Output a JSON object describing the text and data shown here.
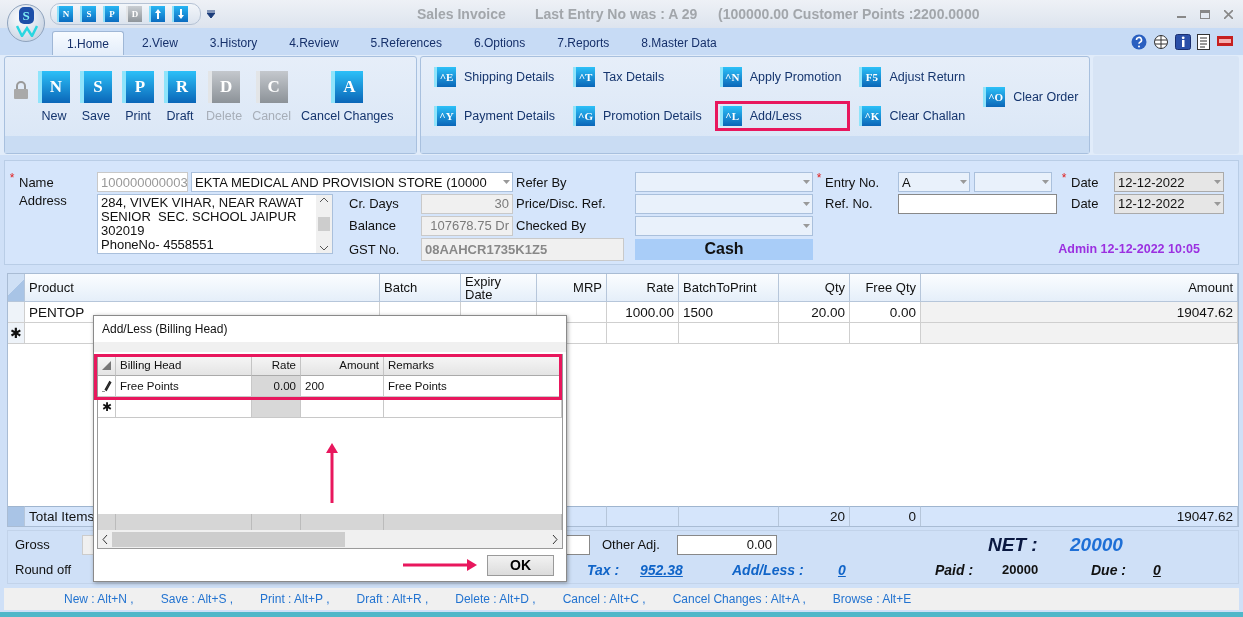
{
  "window": {
    "logo_letter": "S",
    "title": "Sales Invoice",
    "last_entry": "Last Entry No was : A 29",
    "points": "(100000.00  Customer Points :2200.0000"
  },
  "quick_access": [
    {
      "kind": "letter",
      "key": "N",
      "disabled": false
    },
    {
      "kind": "letter",
      "key": "S",
      "disabled": false
    },
    {
      "kind": "letter",
      "key": "P",
      "disabled": false
    },
    {
      "kind": "letter",
      "key": "D",
      "disabled": true
    },
    {
      "kind": "up",
      "disabled": false
    },
    {
      "kind": "down",
      "disabled": false
    }
  ],
  "tabs": [
    {
      "label": "1.Home",
      "selected": true
    },
    {
      "label": "2.View",
      "selected": false
    },
    {
      "label": "3.History",
      "selected": false
    },
    {
      "label": "4.Review",
      "selected": false
    },
    {
      "label": "5.References",
      "selected": false
    },
    {
      "label": "6.Options",
      "selected": false
    },
    {
      "label": "7.Reports",
      "selected": false
    },
    {
      "label": "8.Master Data",
      "selected": false
    }
  ],
  "ribbon": {
    "main_buttons": [
      {
        "key": "N",
        "label": "New",
        "disabled": false
      },
      {
        "key": "S",
        "label": "Save",
        "disabled": false
      },
      {
        "key": "P",
        "label": "Print",
        "disabled": false
      },
      {
        "key": "R",
        "label": "Draft",
        "disabled": false
      },
      {
        "key": "D",
        "label": "Delete",
        "disabled": true
      },
      {
        "key": "C",
        "label": "Cancel",
        "disabled": true
      },
      {
        "key": "A",
        "label": "Cancel Changes",
        "disabled": false
      }
    ],
    "actions": [
      [
        {
          "key": "^E",
          "label": "Shipping Details",
          "highlighted": false
        },
        {
          "key": "^Y",
          "label": "Payment Details",
          "highlighted": false
        }
      ],
      [
        {
          "key": "^T",
          "label": "Tax Details",
          "highlighted": false
        },
        {
          "key": "^G",
          "label": "Promotion Details",
          "highlighted": false
        }
      ],
      [
        {
          "key": "^N",
          "label": "Apply Promotion",
          "highlighted": false
        },
        {
          "key": "^L",
          "label": "Add/Less",
          "highlighted": true
        }
      ],
      [
        {
          "key": "F5",
          "label": "Adjust Return",
          "highlighted": false
        },
        {
          "key": "^K",
          "label": "Clear Challan",
          "highlighted": false
        }
      ],
      [
        {
          "key": "^O",
          "label": "Clear Order",
          "highlighted": false
        }
      ]
    ]
  },
  "customer": {
    "name_label": "Name",
    "required_mark": "*",
    "address_label": "Address",
    "code": "100000000003",
    "name": "EKTA MEDICAL AND PROVISION STORE (10000",
    "address": "284, VIVEK VIHAR, NEAR RAWAT\nSENIOR  SEC. SCHOOL JAIPUR\n302019\nPhoneNo- 4558551",
    "details": [
      {
        "label": "Cr. Days",
        "value": "30"
      },
      {
        "label": "Balance",
        "value": "107678.75 Dr"
      },
      {
        "label": "GST No.",
        "value": "08AAHCR1735K1Z5"
      }
    ]
  },
  "references": [
    {
      "label": "Refer By"
    },
    {
      "label": "Price/Disc. Ref."
    },
    {
      "label": "Checked By"
    }
  ],
  "payment_mode": "Cash",
  "entry": {
    "label": "Entry No.",
    "required_mark": "*",
    "series": "A",
    "ref_label": "Ref. No.",
    "dates": [
      {
        "label": "Date",
        "value": "12-12-2022",
        "required_mark": "*"
      },
      {
        "label": "Date",
        "value": "12-12-2022"
      }
    ],
    "user_stamp": "Admin 12-12-2022 10:05"
  },
  "grid": {
    "columns": [
      {
        "label": "Product",
        "kind": "text"
      },
      {
        "label": "Batch",
        "kind": "text"
      },
      {
        "label": "Expiry Date",
        "kind": "text"
      },
      {
        "label": "MRP",
        "kind": "number"
      },
      {
        "label": "Rate",
        "kind": "number"
      },
      {
        "label": "BatchToPrint",
        "kind": "text"
      },
      {
        "label": "Qty",
        "kind": "number"
      },
      {
        "label": "Free Qty",
        "kind": "number"
      },
      {
        "label": "Amount",
        "kind": "number"
      }
    ],
    "rows": [
      {
        "kind": "data",
        "cells": [
          "PENTOP",
          null,
          null,
          null,
          "1000.00",
          "1500",
          "20.00",
          "0.00",
          "19047.62"
        ]
      },
      {
        "kind": "new",
        "marker": "✱"
      }
    ],
    "totals": {
      "label": "Total Items",
      "cells": [
        null,
        null,
        null,
        null,
        null,
        "20",
        "0",
        "19047.62"
      ]
    }
  },
  "summary": {
    "gross_label": "Gross",
    "round_off_label": "Round off",
    "other_adj_label": "Other Adj.",
    "other_adj": "0.00",
    "tax_label": "Tax :",
    "tax": "952.38",
    "add_less_label": "Add/Less :",
    "add_less": "0",
    "net_label": "NET :",
    "net": "20000",
    "paid_label": "Paid :",
    "paid": "20000",
    "due_label": "Due :",
    "due": "0"
  },
  "shortcuts": [
    "New : Alt+N ,",
    "Save : Alt+S ,",
    "Print : Alt+P ,",
    "Draft : Alt+R ,",
    "Delete : Alt+D ,",
    "Cancel : Alt+C ,",
    "Cancel Changes : Alt+A ,",
    "Browse : Alt+E"
  ],
  "dialog": {
    "title": "Add/Less (Billing Head)",
    "highlighted": true,
    "columns": [
      {
        "label": "Billing Head",
        "kind": "text",
        "readonly": false
      },
      {
        "label": "Rate",
        "kind": "number",
        "readonly": true
      },
      {
        "label": "Amount",
        "kind": "entry",
        "readonly": false
      },
      {
        "label": "Remarks",
        "kind": "text",
        "readonly": false
      }
    ],
    "rows": [
      {
        "kind": "editing",
        "cells": [
          "Free Points",
          "0.00",
          "200",
          "Free Points"
        ]
      },
      {
        "kind": "new",
        "marker": "✱"
      }
    ],
    "ok": "OK"
  }
}
